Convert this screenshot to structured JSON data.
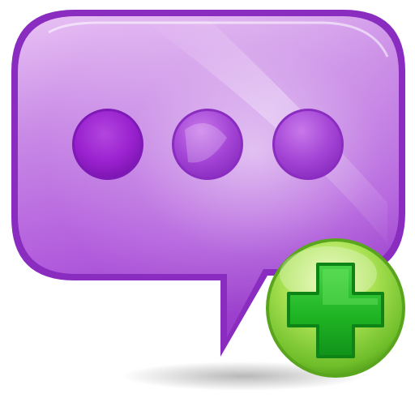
{
  "icon": {
    "name": "add-chat-message-icon",
    "bubble_icon": "chat-bubble-icon",
    "dots_icon": "ellipsis-icon",
    "badge_icon": "plus-icon"
  },
  "colors": {
    "bubble_light": "#E2B6F0",
    "bubble_mid": "#B861DE",
    "bubble_dark": "#8B2FC0",
    "bubble_outline": "#7A23AE",
    "dot_dark": "#9320C9",
    "badge_light": "#D6F58A",
    "badge_mid": "#8ED43A",
    "badge_dark": "#4C9A18",
    "plus_green": "#1AB11F",
    "plus_outline": "#0C7E12"
  }
}
